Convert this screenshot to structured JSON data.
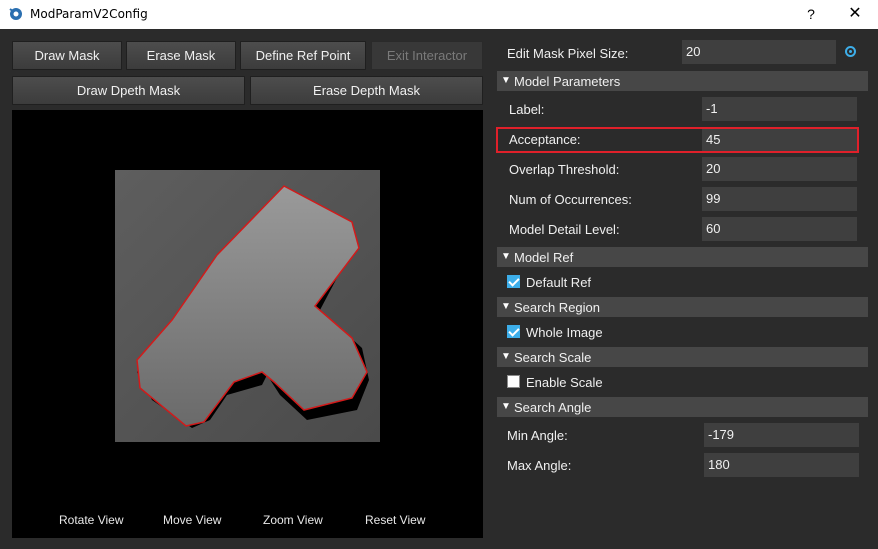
{
  "window": {
    "title": "ModParamV2Config",
    "help_label": "?",
    "close_label": "✕"
  },
  "toolbar": {
    "draw_mask": "Draw Mask",
    "erase_mask": "Erase Mask",
    "define_ref_point": "Define Ref Point",
    "exit_interactor": "Exit Interactor",
    "draw_depth_mask": "Draw Dpeth Mask",
    "erase_depth_mask": "Erase Depth Mask"
  },
  "viewer": {
    "rotate": "Rotate View",
    "move": "Move View",
    "zoom": "Zoom View",
    "reset": "Reset View"
  },
  "mask": {
    "label": "Edit Mask Pixel Size:",
    "value": "20"
  },
  "model_parameters": {
    "title": "Model Parameters",
    "label": {
      "name": "Label:",
      "value": "-1"
    },
    "acceptance": {
      "name": "Acceptance:",
      "value": "45"
    },
    "overlap": {
      "name": "Overlap Threshold:",
      "value": "20"
    },
    "occurrences": {
      "name": "Num of Occurrences:",
      "value": "99"
    },
    "detail": {
      "name": "Model Detail Level:",
      "value": "60"
    }
  },
  "model_ref": {
    "title": "Model Ref",
    "checkbox": "Default Ref",
    "checked": true
  },
  "search_region": {
    "title": "Search Region",
    "checkbox": "Whole Image",
    "checked": true
  },
  "search_scale": {
    "title": "Search Scale",
    "checkbox": "Enable Scale",
    "checked": false
  },
  "search_angle": {
    "title": "Search Angle",
    "min": {
      "name": "Min Angle:",
      "value": "-179"
    },
    "max": {
      "name": "Max Angle:",
      "value": "180"
    }
  },
  "colors": {
    "accent": "#3daee9",
    "highlight": "#e0202a",
    "background": "#2b2b2b"
  }
}
